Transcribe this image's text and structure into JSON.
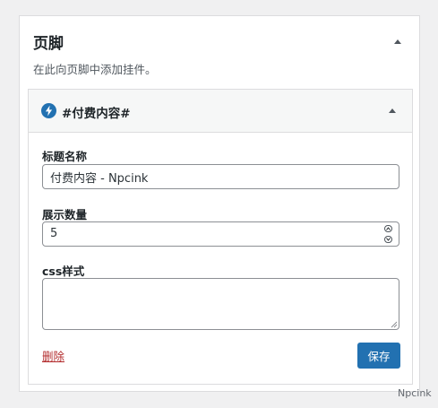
{
  "panel": {
    "title": "页脚",
    "description": "在此向页脚中添加挂件。"
  },
  "widget": {
    "title": "#付费内容#",
    "icon": "lightning-bolt-icon",
    "icon_color": "#2271b1",
    "fields": {
      "title_label": "标题名称",
      "title_value": "付费内容 - Npcink",
      "count_label": "展示数量",
      "count_value": "5",
      "css_label": "css样式",
      "css_value": ""
    },
    "delete_label": "删除",
    "save_label": "保存"
  },
  "watermark": "Npcink",
  "colors": {
    "primary": "#2271b1",
    "danger": "#b32d2e",
    "background": "#f0f0f1"
  }
}
